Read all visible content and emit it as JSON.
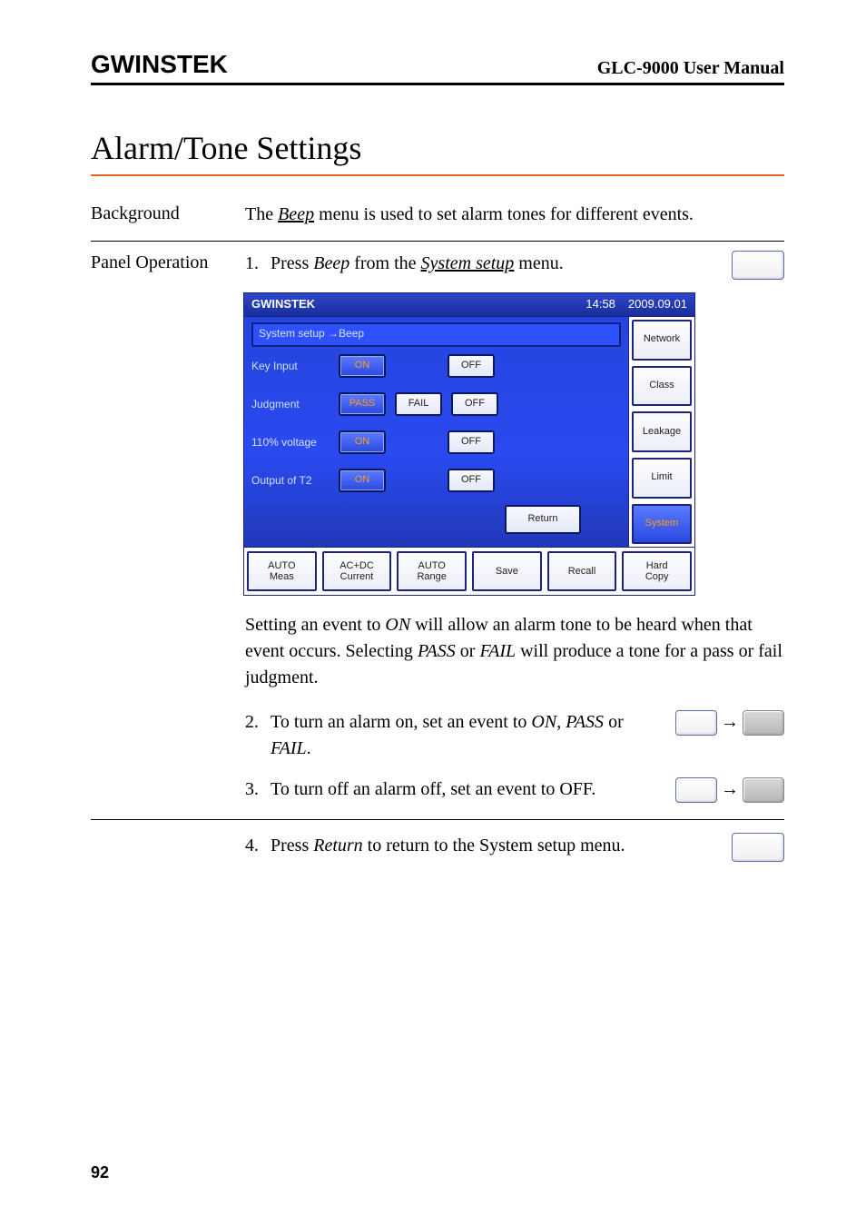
{
  "header": {
    "brand": "G INSTEK",
    "brand_logo_text": "GWINSTEK",
    "manual": "GLC-9000 User Manual"
  },
  "section_title": "Alarm/Tone Settings",
  "background": {
    "label": "Background",
    "text_pre": "The ",
    "beep": "Beep",
    "text_mid": " menu is used to set alarm tones for different events."
  },
  "panel_op_label": "Panel Operation",
  "steps": {
    "s1_num": "1.",
    "s1_a": "Press ",
    "s1_beep": "Beep",
    "s1_b": " from the ",
    "s1_system_setup": "System setup",
    "s1_c": " menu.",
    "para_a": "Setting an event to ",
    "para_on": "ON",
    "para_b": " will allow an alarm tone to be heard when that event occurs. Selecting ",
    "para_pass": "PASS",
    "para_c": " or ",
    "para_fail": "FAIL",
    "para_d": " will produce a tone for a pass or fail judgment.",
    "s2_num": "2.",
    "s2_a": "To turn an alarm on, set an event to ",
    "s2_on": "ON",
    "s2_b": ", ",
    "s2_pass": "PASS",
    "s2_c": " or ",
    "s2_fail": "FAIL",
    "s2_d": ".",
    "s3_num": "3.",
    "s3_a": "To turn off an alarm off, set an event to OFF.",
    "s4_num": "4.",
    "s4_a": "Press ",
    "s4_return": "Return",
    "s4_b": " to return to the System setup menu."
  },
  "device": {
    "brand": "GWINSTEK",
    "time": "14:58",
    "date": "2009.09.01",
    "breadcrumb": "System setup →Beep",
    "rows": [
      {
        "name": "Key Input",
        "opts": [
          "ON",
          "",
          "OFF"
        ],
        "sel": 0
      },
      {
        "name": "Judgment",
        "opts": [
          "PASS",
          "FAIL",
          "OFF"
        ],
        "sel": 0
      },
      {
        "name": "110% voltage",
        "opts": [
          "ON",
          "",
          "OFF"
        ],
        "sel": 0
      },
      {
        "name": "Output of T2",
        "opts": [
          "ON",
          "",
          "OFF"
        ],
        "sel": 0
      }
    ],
    "return": "Return",
    "side": [
      "Network",
      "Class",
      "Leakage",
      "Limit",
      "System"
    ],
    "side_selected": 4,
    "bottom": [
      "AUTO\nMeas",
      "AC+DC\nCurrent",
      "AUTO\nRange",
      "Save",
      "Recall",
      "Hard\nCopy"
    ]
  },
  "arrow": "→",
  "page_number": "92"
}
